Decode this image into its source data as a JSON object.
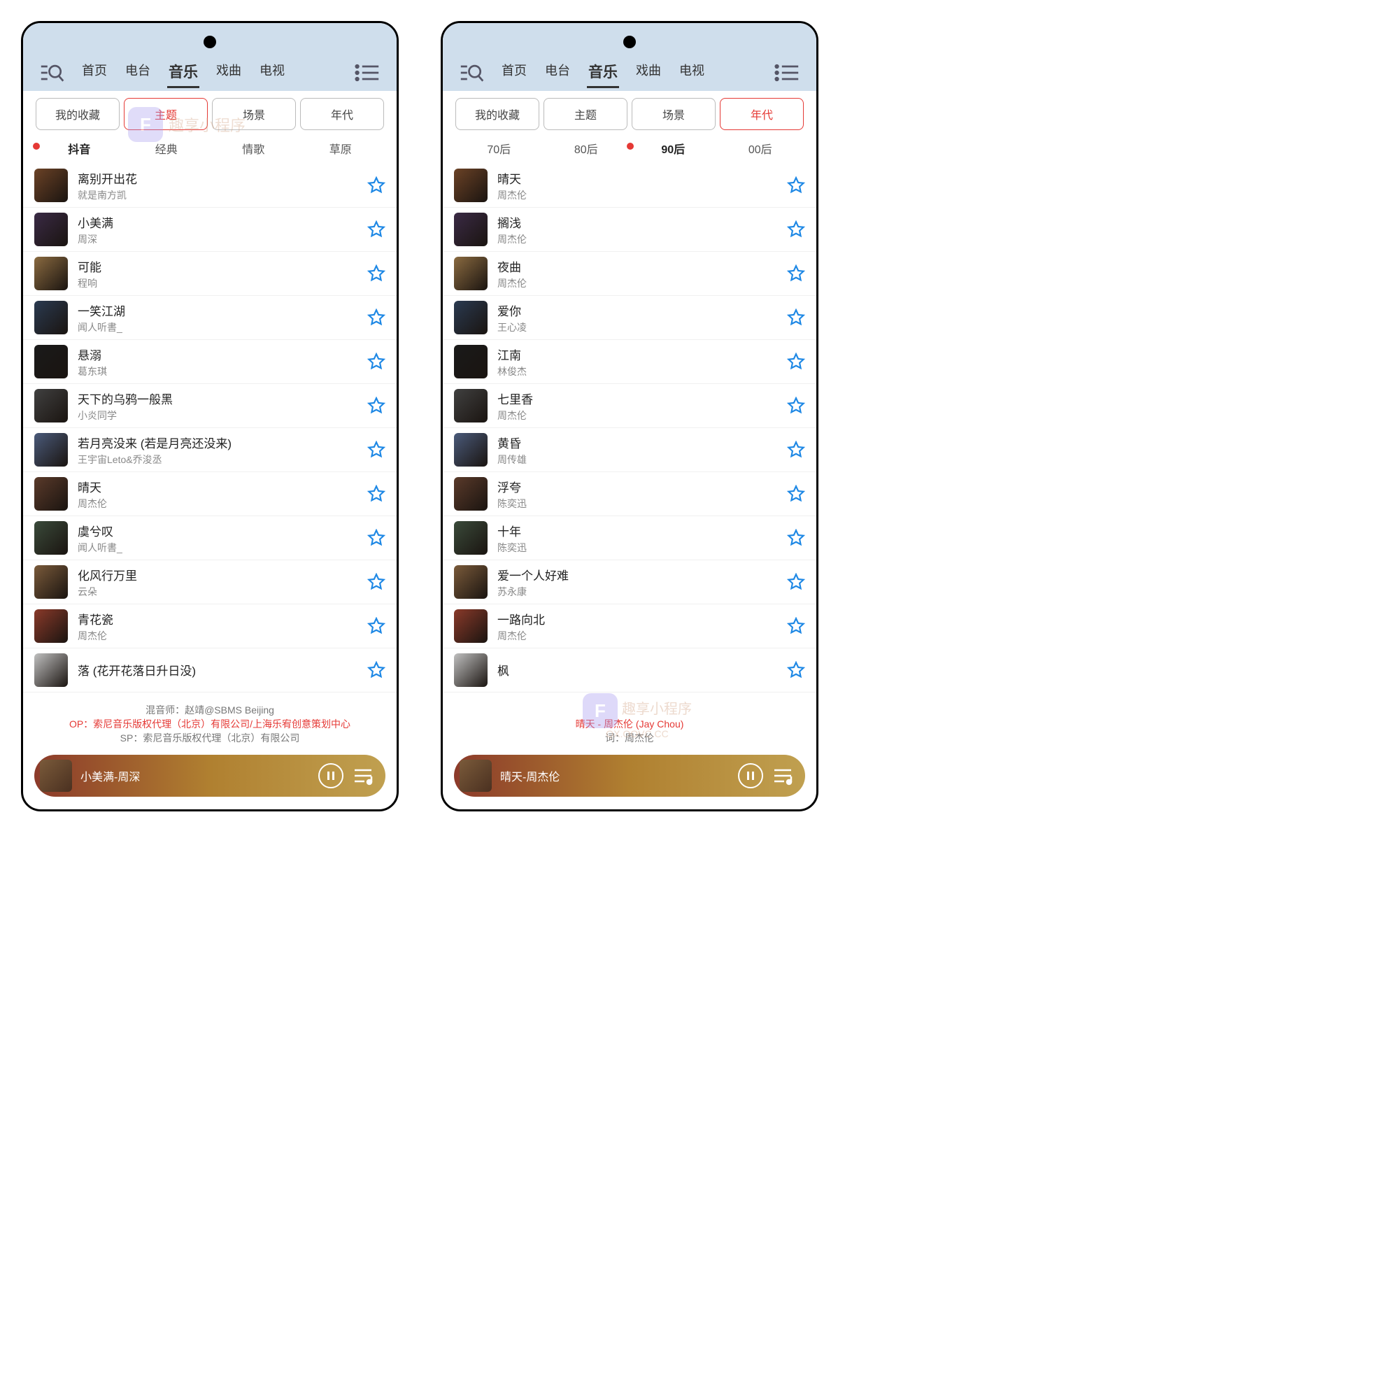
{
  "watermark": {
    "logo": "F",
    "text": "趣享小程序",
    "url": "QX.OOVC.CC"
  },
  "left": {
    "nav": [
      "首页",
      "电台",
      "音乐",
      "戏曲",
      "电视"
    ],
    "nav_active": 2,
    "filters": [
      "我的收藏",
      "主题",
      "场景",
      "年代"
    ],
    "filter_active": 1,
    "cats": [
      "抖音",
      "经典",
      "情歌",
      "草原"
    ],
    "cat_active": 0,
    "songs": [
      {
        "title": "离别开出花",
        "artist": "就是南方凯"
      },
      {
        "title": "小美满",
        "artist": "周深"
      },
      {
        "title": "可能",
        "artist": "程响"
      },
      {
        "title": "一笑江湖",
        "artist": "闻人听書_"
      },
      {
        "title": "悬溺",
        "artist": "葛东琪"
      },
      {
        "title": "天下的乌鸦一般黑",
        "artist": "小炎同学"
      },
      {
        "title": "若月亮没来 (若是月亮还没来)",
        "artist": "王宇宙Leto&乔浚丞"
      },
      {
        "title": "晴天",
        "artist": "周杰伦"
      },
      {
        "title": "虞兮叹",
        "artist": "闻人听書_"
      },
      {
        "title": "化风行万里",
        "artist": "云朵"
      },
      {
        "title": "青花瓷",
        "artist": "周杰伦"
      },
      {
        "title": "落 (花开花落日升日没)",
        "artist": ""
      }
    ],
    "credits": {
      "line1": "混音师：赵靖@SBMS Beijing",
      "line2": "OP：索尼音乐版权代理（北京）有限公司/上海乐宥创意策划中心",
      "line3": "SP：索尼音乐版权代理（北京）有限公司"
    },
    "player": "小美满-周深"
  },
  "right": {
    "nav": [
      "首页",
      "电台",
      "音乐",
      "戏曲",
      "电视"
    ],
    "nav_active": 2,
    "filters": [
      "我的收藏",
      "主题",
      "场景",
      "年代"
    ],
    "filter_active": 3,
    "cats": [
      "70后",
      "80后",
      "90后",
      "00后"
    ],
    "cat_active": 2,
    "songs": [
      {
        "title": "晴天",
        "artist": "周杰伦"
      },
      {
        "title": "搁浅",
        "artist": "周杰伦"
      },
      {
        "title": "夜曲",
        "artist": "周杰伦"
      },
      {
        "title": "爱你",
        "artist": "王心凌"
      },
      {
        "title": "江南",
        "artist": "林俊杰"
      },
      {
        "title": "七里香",
        "artist": "周杰伦"
      },
      {
        "title": "黄昏",
        "artist": "周传雄"
      },
      {
        "title": "浮夸",
        "artist": "陈奕迅"
      },
      {
        "title": "十年",
        "artist": "陈奕迅"
      },
      {
        "title": "爱一个人好难",
        "artist": "苏永康"
      },
      {
        "title": "一路向北",
        "artist": "周杰伦"
      },
      {
        "title": "枫",
        "artist": ""
      }
    ],
    "credits": {
      "line1": "晴天 - 周杰伦 (Jay Chou)",
      "line2": "词：周杰伦"
    },
    "player": "晴天-周杰伦"
  }
}
